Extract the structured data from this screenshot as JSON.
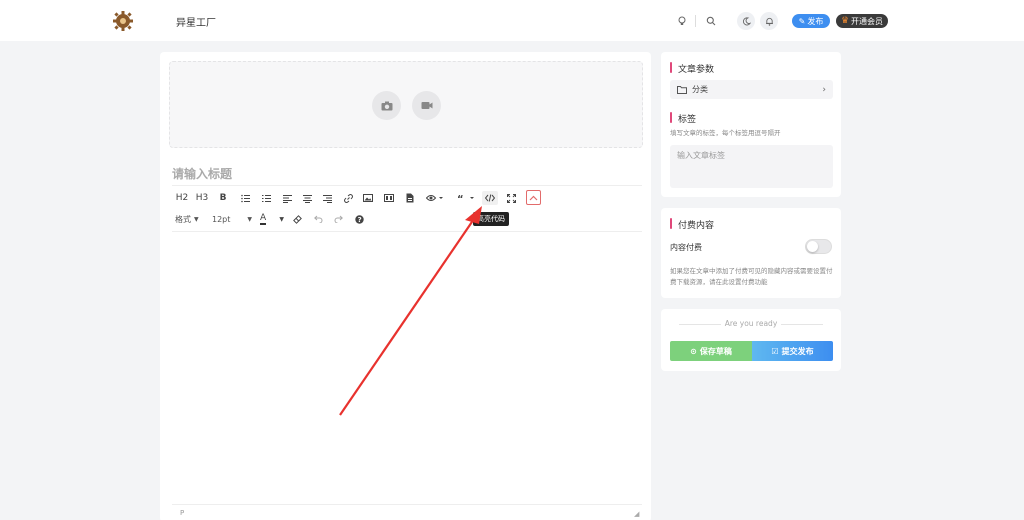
{
  "header": {
    "site_name": "异星工厂",
    "publish_label": "发布",
    "vip_label": "开通会员"
  },
  "editor": {
    "title_placeholder": "请输入标题",
    "toolbar_row1": [
      "H2",
      "H3",
      "B"
    ],
    "toolbar_row2": {
      "format_label": "格式",
      "font_size": "12pt",
      "font_color_label": "A"
    },
    "tooltip": "高亮代码",
    "status_path": "P"
  },
  "sidebar": {
    "params_title": "文章参数",
    "category_label": "分类",
    "tags_title": "标签",
    "tags_hint": "填写文章的标签，每个标签用逗号隔开",
    "tags_placeholder": "输入文章标签",
    "paid_title": "付费内容",
    "paid_toggle_label": "内容付费",
    "paid_hint": "如果您在文章中添加了付费可见的隐藏内容或需要设置付费下载资源，请在此设置付费功能",
    "ready_text": "Are you ready",
    "save_draft_label": "保存草稿",
    "submit_label": "提交发布"
  },
  "colors": {
    "accent_blue": "#3d8ef0",
    "accent_green": "#7dd17c",
    "section_marker": "#e0487a",
    "annotation_arrow": "#e8322e"
  }
}
